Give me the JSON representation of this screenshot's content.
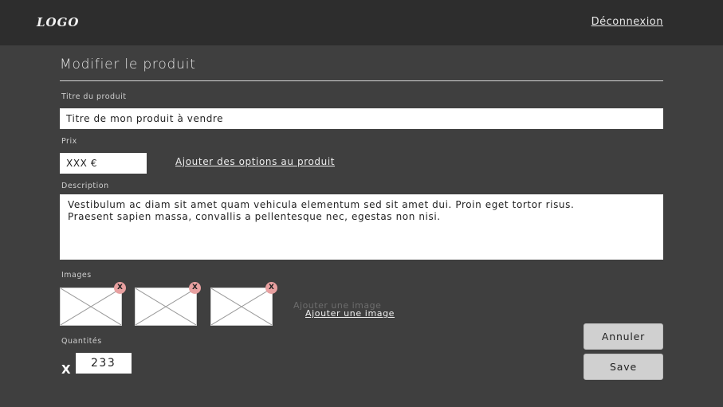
{
  "header": {
    "logo": "LOGO",
    "logout_label": "Déconnexion"
  },
  "page": {
    "title": "Modifier le produit"
  },
  "form": {
    "title_label": "Titre du produit",
    "title_value": "Titre de mon produit à vendre",
    "price_label": "Prix",
    "price_value": "XXX €",
    "options_link": "Ajouter des options au produit",
    "description_label": "Description",
    "description_value": "Vestibulum ac diam sit amet quam vehicula elementum sed sit amet dui. Proin eget tortor risus.\nPraesent sapien massa, convallis a pellentesque nec, egestas non nisi.",
    "images_label": "Images",
    "remove_label": "X",
    "add_image_ghost": "Ajouter une image",
    "add_image_link": "Ajouter une image",
    "quantity_label": "Quantités",
    "quantity_prefix": "X",
    "quantity_value": "233"
  },
  "actions": {
    "cancel_label": "Annuler",
    "save_label": "Save"
  },
  "colors": {
    "background": "#3f3f3f",
    "header": "#2d2d2d",
    "remove_badge": "#e8a0a0",
    "button": "#d0d0d0"
  }
}
